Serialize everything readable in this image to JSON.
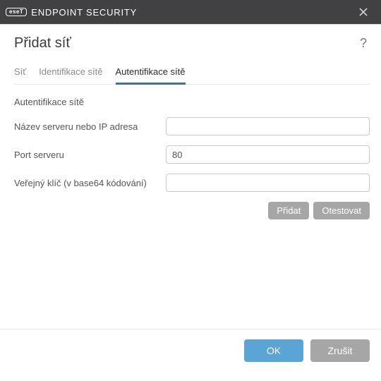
{
  "titlebar": {
    "brand_badge": "eseT",
    "brand_text": "ENDPOINT SECURITY"
  },
  "page": {
    "title": "Přidat síť",
    "help_label": "?"
  },
  "tabs": [
    {
      "label": "Síť"
    },
    {
      "label": "Identifikace sítě"
    },
    {
      "label": "Autentifikace sítě",
      "active": true
    }
  ],
  "section": {
    "heading": "Autentifikace sítě"
  },
  "fields": {
    "server_label": "Název serveru nebo IP adresa",
    "server_value": "",
    "port_label": "Port serveru",
    "port_value": "80",
    "pubkey_label": "Veřejný klíč (v base64 kódování)",
    "pubkey_value": ""
  },
  "buttons": {
    "add": "Přidat",
    "test": "Otestovat",
    "ok": "OK",
    "cancel": "Zrušit"
  }
}
